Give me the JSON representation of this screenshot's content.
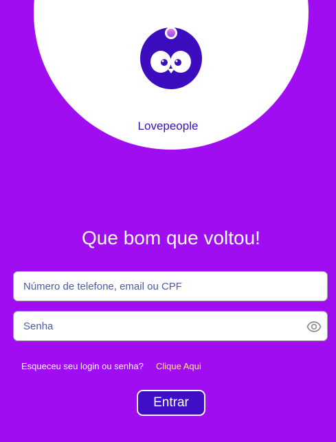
{
  "app": {
    "name": "Lovepeople"
  },
  "login": {
    "heading": "Que bom que voltou!",
    "identifier_placeholder": "Número de telefone, email ou CPF",
    "password_placeholder": "Senha",
    "forgot_text": "Esqueceu seu login ou senha?",
    "forgot_link": "Clique Aqui",
    "submit_label": "Entrar"
  },
  "icons": {
    "logo": "owl-logo-icon",
    "password_toggle": "eye-icon"
  },
  "colors": {
    "background": "#A00DF0",
    "brand_text": "#3B0DBE",
    "accent_link": "#FFE97A",
    "button": "#3E0FC6"
  }
}
